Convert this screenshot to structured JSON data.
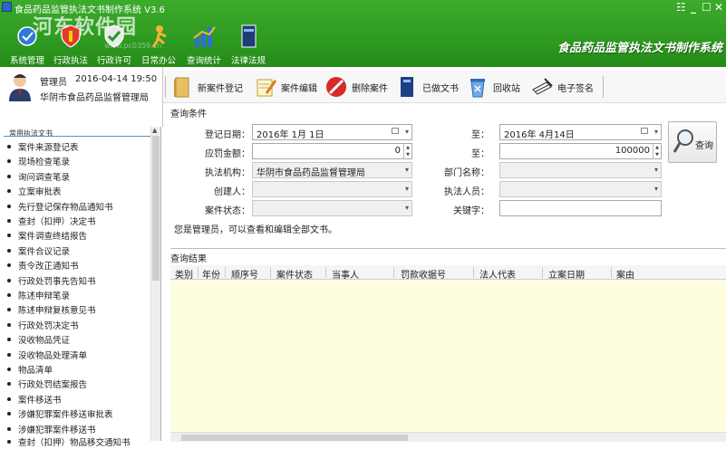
{
  "window": {
    "title": "食品药品监管执法文书制作系统 V3.6",
    "brand_title": "食品药品监管执法文书制作系统",
    "minimize": "_",
    "maximize": "☐",
    "close": "✕"
  },
  "watermark": {
    "text": "河东软件园",
    "url": "www.pc0359.cn"
  },
  "modules": [
    {
      "label": "系统管理",
      "icon": "system-settings-icon"
    },
    {
      "label": "行政执法",
      "icon": "shield-icon"
    },
    {
      "label": "行政许可",
      "icon": "check-shield-icon"
    },
    {
      "label": "日常办公",
      "icon": "person-icon"
    },
    {
      "label": "查询统计",
      "icon": "chart-icon"
    },
    {
      "label": "法律法规",
      "icon": "book-icon"
    }
  ],
  "user": {
    "role": "管理员",
    "datetime": "2016-04-14 19:50",
    "org": "华阴市食品药品监督管理局"
  },
  "toolbar": {
    "new_case": "新案件登记",
    "edit_case": "案件编辑",
    "delete_case": "删除案件",
    "done_docs": "已做文书",
    "recycle": "回收站",
    "esign": "电子签名"
  },
  "sidebar": {
    "header": "常用执法文书",
    "items": [
      "案件来源登记表",
      "现场检查笔录",
      "询问调查笔录",
      "立案审批表",
      "先行登记保存物品通知书",
      "查封（扣押）决定书",
      "案件调查终结报告",
      "案件合议记录",
      "责令改正通知书",
      "行政处罚事先告知书",
      "陈述申辩笔录",
      "陈述申辩复核意见书",
      "行政处罚决定书",
      "没收物品凭证",
      "没收物品处理清单",
      "物品清单",
      "行政处罚结案报告",
      "案件移送书",
      "涉嫌犯罪案件移送审批表",
      "涉嫌犯罪案件移送书",
      "查封（扣押）物品移交通知书"
    ]
  },
  "query": {
    "section_label": "查询条件",
    "reg_date_label": "登记日期：",
    "reg_date_from": "2016年 1月 1日",
    "to_label": "至：",
    "reg_date_to": "2016年 4月14日",
    "fine_label": "应罚金额：",
    "fine_from": "0",
    "fine_to": "100000",
    "agency_label": "执法机构：",
    "agency_value": "华阴市食品药品监督管理局",
    "dept_label": "部门名称：",
    "dept_value": "",
    "creator_label": "创建人：",
    "creator_value": "",
    "officer_label": "执法人员：",
    "officer_value": "",
    "status_label": "案件状态：",
    "status_value": "",
    "keyword_label": "关键字：",
    "keyword_value": "",
    "search_button": "查询",
    "note": "您是管理员，可以查看和编辑全部文书。"
  },
  "results": {
    "section_label": "查询结果",
    "columns": [
      "类别",
      "年份",
      "顺序号",
      "案件状态",
      "当事人",
      "罚款收据号",
      "法人代表",
      "立案日期",
      "案由"
    ],
    "rows": []
  }
}
